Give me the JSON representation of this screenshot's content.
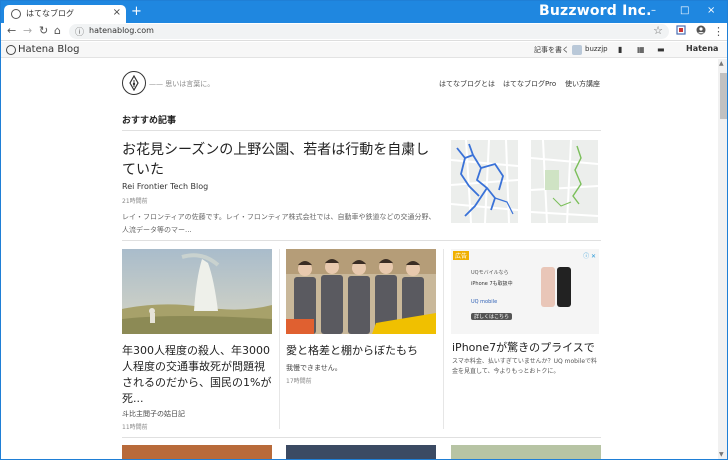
{
  "browser": {
    "tab_title": "はてなブログ",
    "tab_close": "×",
    "new_tab": "+",
    "brand_overlay": "Buzzword Inc.",
    "window_controls": [
      "–",
      "□",
      "×"
    ],
    "nav": {
      "back": "←",
      "forward": "→",
      "reload": "↻",
      "home": "⌂"
    },
    "url": "hatenablog.com",
    "secure_icon": "ⓘ",
    "star": "☆"
  },
  "hatena_header": {
    "logo": "Hatena Blog",
    "write_article": "記事を書く",
    "user": "buzzjp",
    "brand": "Hatena"
  },
  "site": {
    "tagline": "—— 思いは言葉に。",
    "nav": [
      "はてなブログとは",
      "はてなブログPro",
      "使い方講座"
    ]
  },
  "section_title": "おすすめ記事",
  "featured": {
    "title": "お花見シーズンの上野公園、若者は行動を自粛していた",
    "author": "Rei Frontier Tech Blog",
    "time": "21時間前",
    "description": "レイ・フロンティアの佐藤です。レイ・フロンティア株式会社では、自動車や鉄道などの交通分野、人流データ等のマー..."
  },
  "cards": [
    {
      "title": "年300人程度の殺人、年3000人程度の交通事故死が問題視されるのだから、国民の1%が死...",
      "author": "斗比主閲子の姑日記",
      "time": "11時間前"
    },
    {
      "title": "愛と格差と棚からぼたもち",
      "author": "我慢できません。",
      "time": "17時間前"
    }
  ],
  "ad": {
    "badge": "広告",
    "close": "ⓘ ✕",
    "line1": "UQモバイルなら",
    "line2": "iPhone 7も取扱中",
    "logo": "UQ mobile",
    "cta": "詳しくはこちら",
    "title": "iPhone7が驚きのプライスで",
    "description": "スマホ料金、払いすぎていませんか？UQ mobileで料金を見直して、今よりもっとおトクに。"
  },
  "colors": {
    "titlebar": "#1f87e0",
    "text": "#222222",
    "muted": "#888888"
  }
}
